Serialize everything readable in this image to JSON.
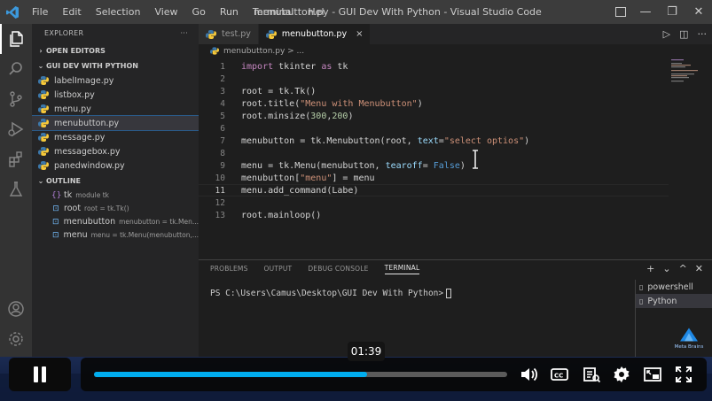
{
  "titlebar": {
    "menu": [
      "File",
      "Edit",
      "Selection",
      "View",
      "Go",
      "Run",
      "Terminal",
      "Hel"
    ],
    "title": "menubutton.py - GUI Dev With Python - Visual Studio Code",
    "minimize": "—",
    "maximize": "❐",
    "close": "✕"
  },
  "sidebar": {
    "header": "EXPLORER",
    "header_more": "···",
    "open_editors": "OPEN EDITORS",
    "folder": "GUI DEV WITH PYTHON",
    "files": [
      "labelImage.py",
      "listbox.py",
      "menu.py",
      "menubutton.py",
      "message.py",
      "messagebox.py",
      "panedwindow.py"
    ],
    "active_file_index": 3,
    "outline": {
      "title": "OUTLINE",
      "items": [
        {
          "symbol": "{}",
          "name": "tk",
          "detail": "module tk"
        },
        {
          "symbol": "⊡",
          "name": "root",
          "detail": "root = tk.Tk()"
        },
        {
          "symbol": "⊡",
          "name": "menubutton",
          "detail": "menubutton = tk.Men..."
        },
        {
          "symbol": "⊡",
          "name": "menu",
          "detail": "menu = tk.Menu(menubutton,..."
        }
      ]
    }
  },
  "tabs": [
    {
      "label": "test.py",
      "active": false
    },
    {
      "label": "menubutton.py",
      "active": true,
      "close": "×"
    }
  ],
  "tab_actions": {
    "run": "▷",
    "split": "◫",
    "more": "···"
  },
  "breadcrumb": "menubutton.py > ...",
  "editor": {
    "current_line": 11,
    "lines": [
      {
        "n": "1",
        "tokens": [
          {
            "t": "import",
            "c": "kw"
          },
          {
            "t": " tkinter ",
            "c": ""
          },
          {
            "t": "as",
            "c": "kw"
          },
          {
            "t": " tk",
            "c": ""
          }
        ]
      },
      {
        "n": "2",
        "tokens": []
      },
      {
        "n": "3",
        "tokens": [
          {
            "t": "root = tk.Tk()",
            "c": ""
          }
        ]
      },
      {
        "n": "4",
        "tokens": [
          {
            "t": "root.title(",
            "c": ""
          },
          {
            "t": "\"Menu with Menubutton\"",
            "c": "str"
          },
          {
            "t": ")",
            "c": ""
          }
        ]
      },
      {
        "n": "5",
        "tokens": [
          {
            "t": "root.minsize(",
            "c": ""
          },
          {
            "t": "300",
            "c": "num"
          },
          {
            "t": ",",
            "c": ""
          },
          {
            "t": "200",
            "c": "num"
          },
          {
            "t": ")",
            "c": ""
          }
        ]
      },
      {
        "n": "6",
        "tokens": []
      },
      {
        "n": "7",
        "tokens": [
          {
            "t": "menubutton = tk.Menubutton(root, ",
            "c": ""
          },
          {
            "t": "text",
            "c": "param"
          },
          {
            "t": "=",
            "c": ""
          },
          {
            "t": "\"select optios\"",
            "c": "str"
          },
          {
            "t": ")",
            "c": ""
          }
        ]
      },
      {
        "n": "8",
        "tokens": []
      },
      {
        "n": "9",
        "tokens": [
          {
            "t": "menu = tk.Menu(menubutton, ",
            "c": ""
          },
          {
            "t": "tearoff",
            "c": "param"
          },
          {
            "t": "= ",
            "c": ""
          },
          {
            "t": "False",
            "c": "const"
          },
          {
            "t": ")",
            "c": ""
          }
        ]
      },
      {
        "n": "10",
        "tokens": [
          {
            "t": "menubutton[",
            "c": ""
          },
          {
            "t": "\"menu\"",
            "c": "str"
          },
          {
            "t": "] = menu",
            "c": ""
          }
        ]
      },
      {
        "n": "11",
        "tokens": [
          {
            "t": "menu.add_command(Labe)",
            "c": ""
          }
        ]
      },
      {
        "n": "12",
        "tokens": []
      },
      {
        "n": "13",
        "tokens": [
          {
            "t": "root.mainloop()",
            "c": ""
          }
        ]
      }
    ]
  },
  "panel": {
    "tabs": [
      "PROBLEMS",
      "OUTPUT",
      "DEBUG CONSOLE",
      "TERMINAL"
    ],
    "active_tab": 3,
    "actions": {
      "add": "+",
      "dropdown": "⌄",
      "close": "✕"
    },
    "terminal_prompt": "PS C:\\Users\\Camus\\Desktop\\GUI Dev With Python>",
    "terminals": [
      "powershell",
      "Python"
    ],
    "active_terminal": 1,
    "brand": "Meta Brains"
  },
  "video": {
    "time": "01:39",
    "progress": 0.66
  },
  "colors": {
    "accent": "#00adef",
    "titlebar": "#3c3c3c",
    "editor_bg": "#1e1e1e"
  }
}
